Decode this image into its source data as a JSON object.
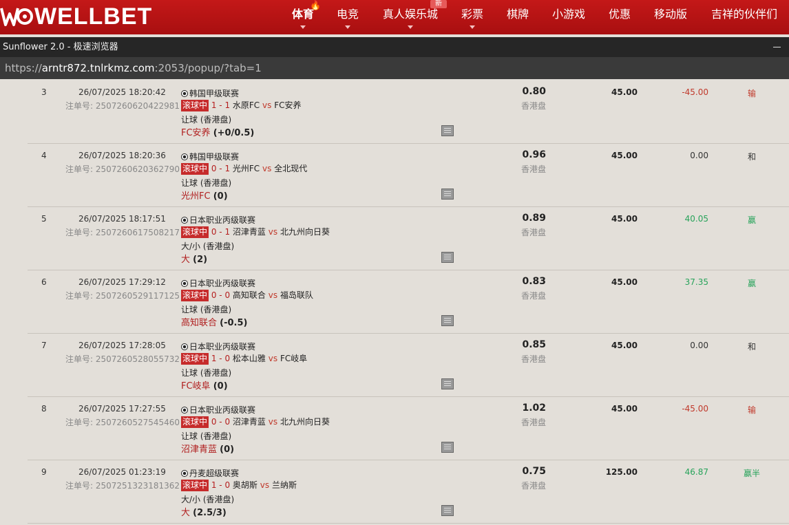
{
  "nav": {
    "brand": "WELLBET",
    "items": [
      {
        "label": "体育",
        "active": true,
        "caret": true
      },
      {
        "label": "电竞",
        "caret": true
      },
      {
        "label": "真人娱乐城",
        "caret": true
      },
      {
        "label": "彩票",
        "caret": true
      },
      {
        "label": "棋牌"
      },
      {
        "label": "小游戏"
      },
      {
        "label": "优惠"
      },
      {
        "label": "移动版"
      },
      {
        "label": "吉祥的伙伴们"
      }
    ],
    "new_badge": "新",
    "accent": "#b5141a"
  },
  "browser": {
    "title": "Sunflower 2.0 - 极速浏览器",
    "url_prefix": "https://",
    "url_host": "arntr872.tnlrkmz.com",
    "url_rest": ":2053/popup/?tab=1"
  },
  "colors": {
    "lose": "#c0392b",
    "win": "#27a35a",
    "live": "#c62b2b"
  },
  "bets": [
    {
      "no": "3",
      "datetime": "26/07/2025 18:20:42",
      "order_label": "注单号:",
      "order": "2507260620422981",
      "league": "韩国甲级联赛",
      "live": "滚球中",
      "score": "1 - 1",
      "home": "水原FC",
      "vs": "vs",
      "away": "FC安养",
      "bet_type": "让球 (香港盘)",
      "selection": "FC安养",
      "handicap": "(+0/0.5)",
      "odds": "0.80",
      "odds_type": "香港盘",
      "stake": "45.00",
      "winloss": "-45.00",
      "result": "输",
      "state": "lose"
    },
    {
      "no": "4",
      "datetime": "26/07/2025 18:20:36",
      "order_label": "注单号:",
      "order": "2507260620362790",
      "league": "韩国甲级联赛",
      "live": "滚球中",
      "score": "0 - 1",
      "home": "光州FC",
      "vs": "vs",
      "away": "全北现代",
      "bet_type": "让球 (香港盘)",
      "selection": "光州FC",
      "handicap": "(0)",
      "odds": "0.96",
      "odds_type": "香港盘",
      "stake": "45.00",
      "winloss": "0.00",
      "result": "和",
      "state": "draw"
    },
    {
      "no": "5",
      "datetime": "26/07/2025 18:17:51",
      "order_label": "注单号:",
      "order": "2507260617508217",
      "league": "日本职业丙级联赛",
      "live": "滚球中",
      "score": "0 - 1",
      "home": "沼津青蓝",
      "vs": "vs",
      "away": "北九州向日葵",
      "bet_type": "大/小 (香港盘)",
      "selection": "大",
      "handicap": "(2)",
      "odds": "0.89",
      "odds_type": "香港盘",
      "stake": "45.00",
      "winloss": "40.05",
      "result": "赢",
      "state": "win"
    },
    {
      "no": "6",
      "datetime": "26/07/2025 17:29:12",
      "order_label": "注单号:",
      "order": "2507260529117125",
      "league": "日本职业丙级联赛",
      "live": "滚球中",
      "score": "0 - 0",
      "home": "高知联合",
      "vs": "vs",
      "away": "福岛联队",
      "bet_type": "让球 (香港盘)",
      "selection": "高知联合",
      "handicap": "(-0.5)",
      "odds": "0.83",
      "odds_type": "香港盘",
      "stake": "45.00",
      "winloss": "37.35",
      "result": "赢",
      "state": "win"
    },
    {
      "no": "7",
      "datetime": "26/07/2025 17:28:05",
      "order_label": "注单号:",
      "order": "2507260528055732",
      "league": "日本职业丙级联赛",
      "live": "滚球中",
      "score": "1 - 0",
      "home": "松本山雅",
      "vs": "vs",
      "away": "FC岐阜",
      "bet_type": "让球 (香港盘)",
      "selection": "FC岐阜",
      "handicap": "(0)",
      "odds": "0.85",
      "odds_type": "香港盘",
      "stake": "45.00",
      "winloss": "0.00",
      "result": "和",
      "state": "draw"
    },
    {
      "no": "8",
      "datetime": "26/07/2025 17:27:55",
      "order_label": "注单号:",
      "order": "2507260527545460",
      "league": "日本职业丙级联赛",
      "live": "滚球中",
      "score": "0 - 0",
      "home": "沼津青蓝",
      "vs": "vs",
      "away": "北九州向日葵",
      "bet_type": "让球 (香港盘)",
      "selection": "沼津青蓝",
      "handicap": "(0)",
      "odds": "1.02",
      "odds_type": "香港盘",
      "stake": "45.00",
      "winloss": "-45.00",
      "result": "输",
      "state": "lose"
    },
    {
      "no": "9",
      "datetime": "26/07/2025 01:23:19",
      "order_label": "注单号:",
      "order": "2507251323181362",
      "league": "丹麦超级联赛",
      "live": "滚球中",
      "score": "1 - 0",
      "home": "奥胡斯",
      "vs": "vs",
      "away": "兰纳斯",
      "bet_type": "大/小 (香港盘)",
      "selection": "大",
      "handicap": "(2.5/3)",
      "odds": "0.75",
      "odds_type": "香港盘",
      "stake": "125.00",
      "winloss": "46.87",
      "result": "赢半",
      "state": "win"
    }
  ]
}
